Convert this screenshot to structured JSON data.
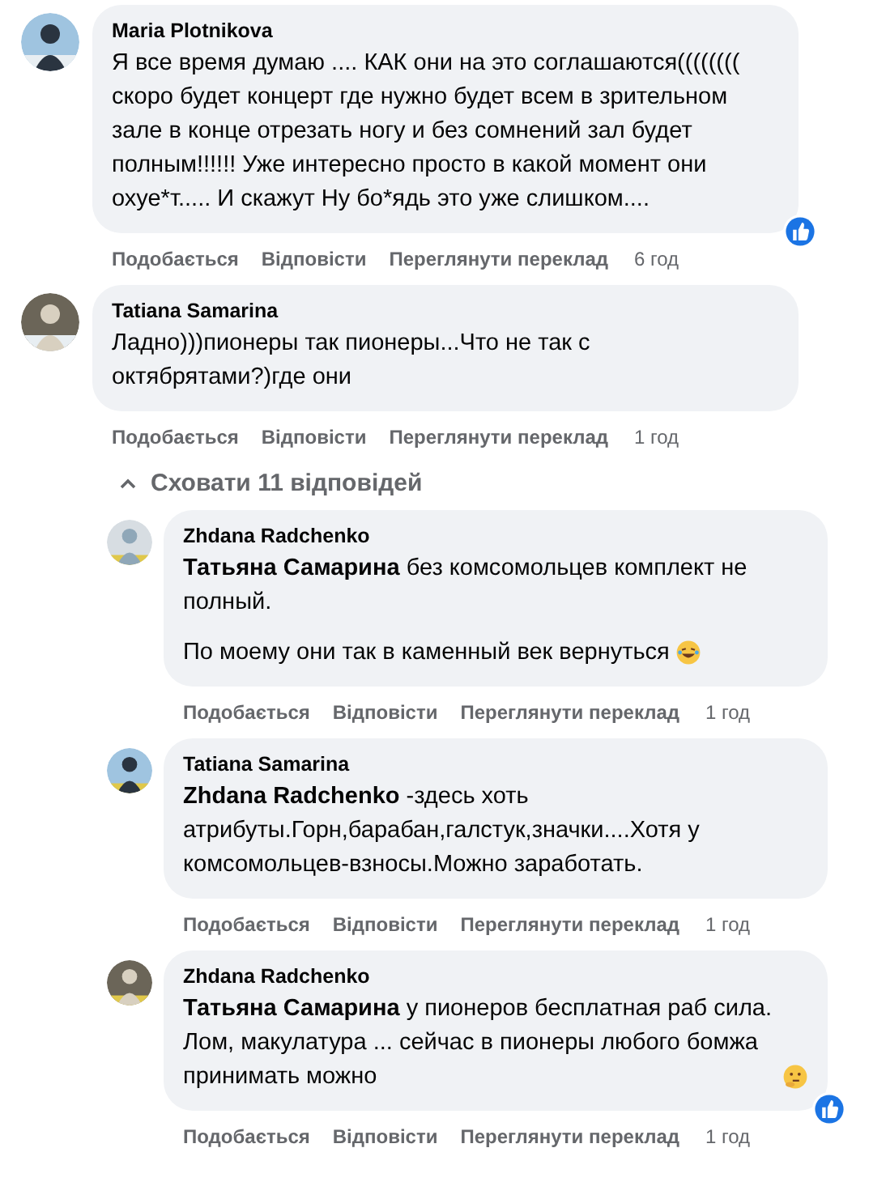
{
  "comments": [
    {
      "author": "Maria Plotnikova",
      "paragraphs": [
        {
          "text": "Я все время думаю .... КАК они на это соглашаются(((((((( скоро будет концерт где нужно будет всем в зрительном зале в конце отрезать ногу и без сомнений зал будет полным!!!!!! Уже интересно просто в какой момент они охуе*т..... И скажут Ну бо*ядь это уже слишком...."
        }
      ],
      "reaction": true,
      "actions": [
        "Подобається",
        "Відповісти",
        "Переглянути переклад"
      ],
      "time": "6 год"
    },
    {
      "author": "Tatiana Samarina",
      "paragraphs": [
        {
          "text": "Ладно)))пионеры так пионеры...Что не так с октябрятами?)где они"
        }
      ],
      "reaction": false,
      "actions": [
        "Подобається",
        "Відповісти",
        "Переглянути переклад"
      ],
      "time": "1 год"
    }
  ],
  "replies_toggle": {
    "label": "Сховати 11 відповідей",
    "expanded": true
  },
  "replies": [
    {
      "author": "Zhdana Radchenko",
      "paragraphs": [
        {
          "text": "**Татьяна Самарина** без комсомольцев комплект не полный.",
          "kind": "plain"
        },
        {
          "text": "По моему они так в каменный век вернуться",
          "kind": "laughing"
        }
      ],
      "reaction": false,
      "actions": [
        "Подобається",
        "Відповісти",
        "Переглянути переклад"
      ],
      "time": "1 год"
    },
    {
      "author": "Tatiana Samarina",
      "paragraphs": [
        {
          "text": "**Zhdana Radchenko** -здесь хоть атрибуты.Горн,барабан,галстук,значки....Хотя у комсомольцев-взносы.Можно заработать."
        }
      ],
      "reaction": false,
      "actions": [
        "Подобається",
        "Відповісти",
        "Переглянути переклад"
      ],
      "time": "1 год"
    },
    {
      "author": "Zhdana Radchenko",
      "paragraphs": [
        {
          "text": "**Татьяна Самарина** у пионеров бесплатная раб сила. Лом, макулатура ... сейчас в пионеры любого бомжа принимать можно",
          "kind": "thinking"
        }
      ],
      "reaction": true,
      "actions": [
        "Подобається",
        "Відповісти",
        "Переглянути переклад"
      ],
      "time": "1 год"
    }
  ]
}
